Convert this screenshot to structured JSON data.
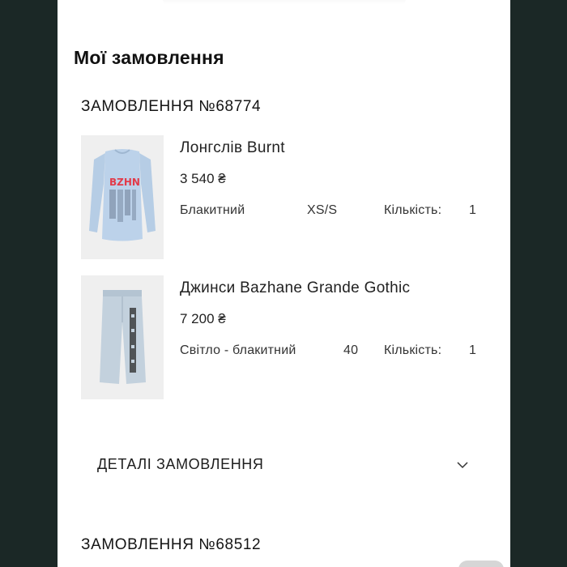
{
  "page": {
    "title": "Мої замовлення"
  },
  "orders": [
    {
      "number": "ЗАМОВЛЕННЯ №68774",
      "items": [
        {
          "name": "Лонгслів Burnt",
          "price": "3 540 ₴",
          "color": "Блакитний",
          "size": "XS/S",
          "quantity_label": "Кількість:",
          "quantity": "1",
          "image_icon": "longsleeve-image"
        },
        {
          "name": "Джинси Bazhane Grande Gothic",
          "price": "7 200 ₴",
          "color": "Світло - блакитний",
          "size": "40",
          "quantity_label": "Кількість:",
          "quantity": "1",
          "image_icon": "jeans-image"
        }
      ],
      "details_label": "ДЕТАЛІ ЗАМОВЛЕННЯ",
      "details_icon": "chevron-down-icon"
    },
    {
      "number": "ЗАМОВЛЕННЯ №68512"
    }
  ],
  "colors": {
    "background": "#1b2826",
    "panel": "#ffffff",
    "text": "#141414",
    "thumb_bg": "#efefef",
    "garment_blue": "#b9cfe6"
  }
}
